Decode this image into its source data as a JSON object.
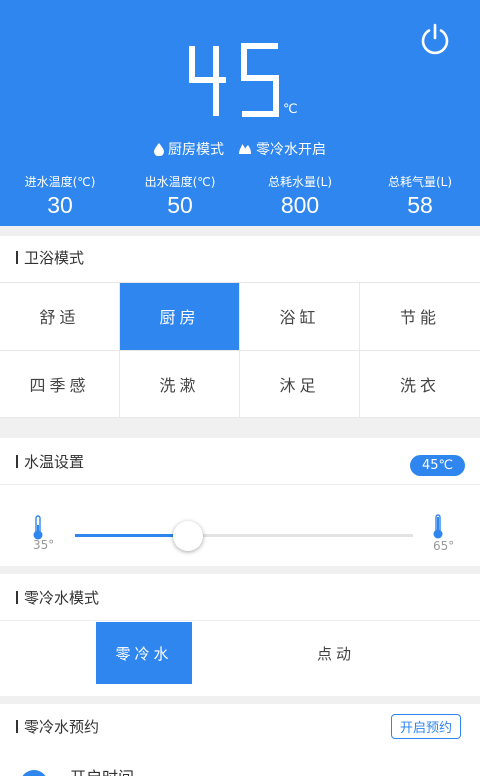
{
  "header": {
    "temperature": "45",
    "unit": "℃",
    "status": [
      {
        "icon": "water-drop-icon",
        "label": "厨房模式"
      },
      {
        "icon": "flame-icon",
        "label": "零冷水开启"
      }
    ],
    "stats": [
      {
        "label": "进水温度(℃)",
        "value": "30"
      },
      {
        "label": "出水温度(℃)",
        "value": "50"
      },
      {
        "label": "总耗水量(L)",
        "value": "800"
      },
      {
        "label": "总耗气量(L)",
        "value": "58"
      }
    ]
  },
  "bath_mode": {
    "title": "卫浴模式",
    "modes": [
      "舒适",
      "厨房",
      "浴缸",
      "节能",
      "四季感",
      "洗漱",
      "沐足",
      "洗衣"
    ],
    "active": "厨房"
  },
  "water_temp": {
    "title": "水温设置",
    "badge": "45℃",
    "min_label": "35°",
    "max_label": "65°",
    "min": 35,
    "max": 65,
    "value": 45
  },
  "zero_cold": {
    "title": "零冷水模式",
    "options": [
      "零冷水",
      "点动"
    ],
    "active": "零冷水"
  },
  "zero_cold_schedule": {
    "title": "零冷水预约",
    "button": "开启预约",
    "time_label": "开启时间"
  },
  "colors": {
    "accent": "#2f86ee"
  }
}
